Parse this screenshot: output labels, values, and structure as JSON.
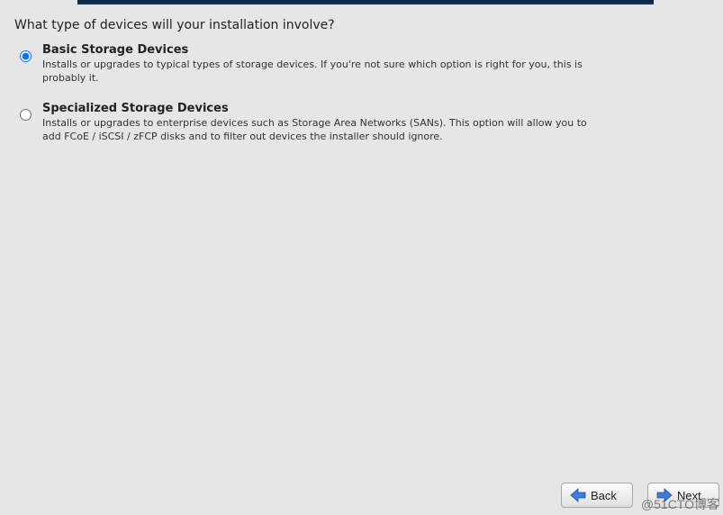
{
  "question": "What type of devices will your installation involve?",
  "options": [
    {
      "title": "Basic Storage Devices",
      "desc": "Installs or upgrades to typical types of storage devices.  If you're not sure which option is right for you, this is probably it.",
      "selected": true
    },
    {
      "title": "Specialized Storage Devices",
      "desc": "Installs or upgrades to enterprise devices such as Storage Area Networks (SANs). This option will allow you to add FCoE / iSCSI / zFCP disks and to filter out devices the installer should ignore.",
      "selected": false
    }
  ],
  "buttons": {
    "back": "Back",
    "next": "Next"
  },
  "watermark": "@51CTO博客"
}
